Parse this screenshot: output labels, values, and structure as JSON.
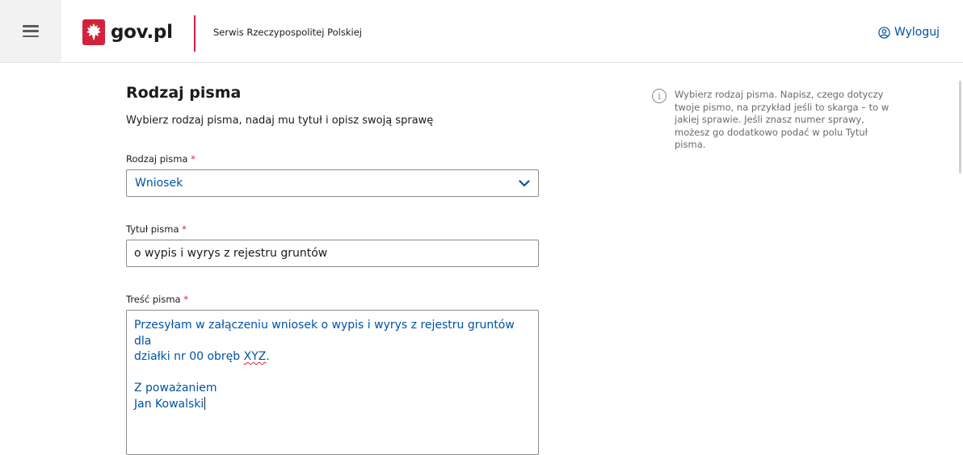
{
  "header": {
    "logo_text": "gov.pl",
    "service_name": "Serwis Rzeczypospolitej Polskiej",
    "logout_label": "Wyloguj",
    "menu_icon": "hamburger-icon",
    "logout_icon": "user-icon",
    "brand_red": "#d4213d",
    "link_blue": "#0052a5"
  },
  "main": {
    "title": "Rodzaj pisma",
    "subtitle": "Wybierz rodzaj pisma, nadaj mu tytuł i opisz swoją sprawę",
    "required_marker": "*",
    "type_field": {
      "label": "Rodzaj pisma",
      "value": "Wniosek"
    },
    "title_field": {
      "label": "Tytuł pisma",
      "value": "o wypis i wyrys z rejestru gruntów"
    },
    "content_field": {
      "label": "Treść pisma",
      "line1": "Przesyłam w załączeniu wniosek o wypis i wyrys z rejestru gruntów dla",
      "line2_prefix": "działki nr 00 obręb ",
      "line2_underlined": "XYZ",
      "line2_suffix": ".",
      "line3": "Z poważaniem",
      "line4": "Jan Kowalski"
    }
  },
  "hint": {
    "icon": "info-icon",
    "text": "Wybierz rodzaj pisma. Napisz, czego dotyczy twoje pismo, na przykład jeśli to skarga – to w jakiej sprawie. Jeśli znasz numer sprawy, możesz go dodatkowo podać w polu Tytuł pisma."
  }
}
